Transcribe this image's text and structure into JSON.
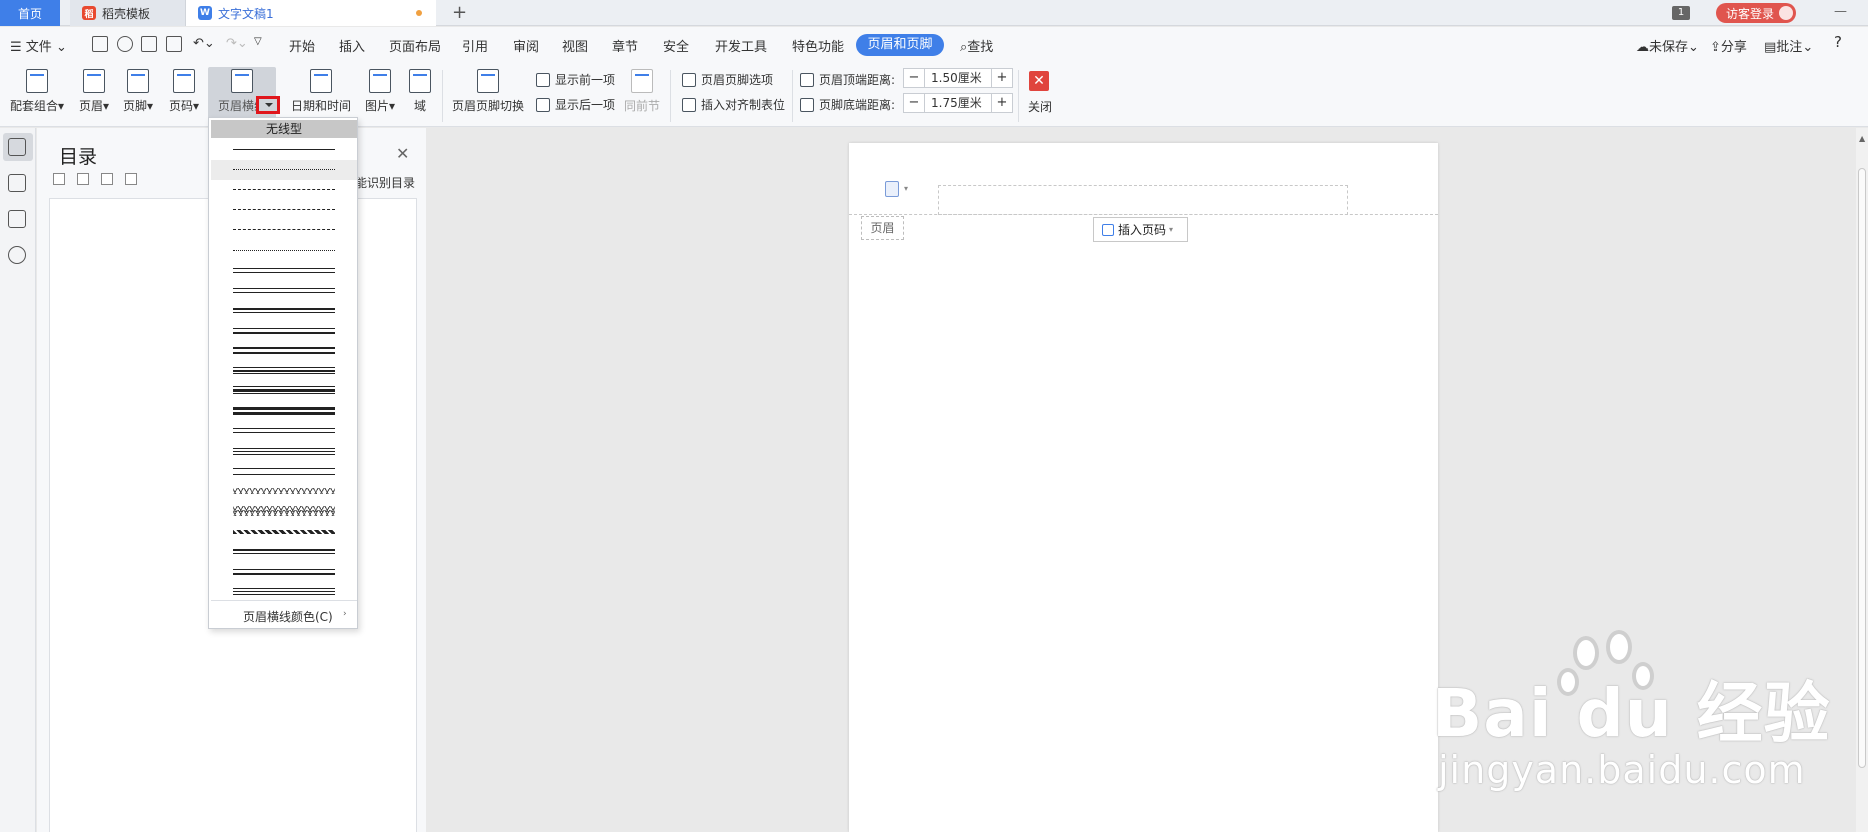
{
  "tabs": {
    "home": "首页",
    "template": "稻壳模板",
    "document": "文字文稿1",
    "add": "+"
  },
  "titlebar": {
    "window_count": "1",
    "guest_login": "访客登录"
  },
  "menu": {
    "file": "文件",
    "items": [
      "开始",
      "插入",
      "页面布局",
      "引用",
      "审阅",
      "视图",
      "章节",
      "安全",
      "开发工具",
      "特色功能",
      "页眉和页脚"
    ],
    "active": "页眉和页脚",
    "search": "查找",
    "unsaved": "未保存",
    "share": "分享",
    "comment": "批注",
    "help": "?"
  },
  "ribbon": {
    "combo": "配套组合",
    "header": "页眉",
    "footer": "页脚",
    "page_number": "页码",
    "header_line": "页眉横线",
    "date_time": "日期和时间",
    "picture": "图片",
    "field": "域",
    "switch": "页眉页脚切换",
    "show_prev": "显示前一项",
    "show_next": "显示后一项",
    "same_as_prev": "同前节",
    "options": "页眉页脚选项",
    "insert_tab": "插入对齐制表位",
    "top_distance_label": "页眉顶端距离:",
    "top_distance_value": "1.50厘米",
    "bottom_distance_label": "页脚底端距离:",
    "bottom_distance_value": "1.75厘米",
    "close": "关闭"
  },
  "toc": {
    "title": "目录",
    "smart": "能识别目录"
  },
  "document": {
    "header_tag": "页眉",
    "insert_page_number": "插入页码"
  },
  "dropdown": {
    "none_label": "无线型",
    "line_color": "页眉横线颜色(C)",
    "line_styles": [
      "single-thin",
      "dotted",
      "dashed-small",
      "dashed",
      "dash-dot",
      "dash-dot-dot",
      "double-thin",
      "double",
      "thick-thin",
      "thin-thick",
      "thick-thick",
      "triple",
      "thin-thick-thin",
      "thick-bar",
      "double-thin-2",
      "triple-thin",
      "double-spaced",
      "wavy",
      "double-wavy",
      "striped",
      "thick-thin-2",
      "thin-thick-2",
      "triple-2"
    ]
  },
  "watermark": {
    "main": "Bai du 经验",
    "sub": "jingyan.baidu.com"
  },
  "colors": {
    "accent": "#3f7fe8",
    "highlight_box": "#e0161c",
    "guest_button": "#e0554e",
    "close_button": "#e0443d"
  }
}
